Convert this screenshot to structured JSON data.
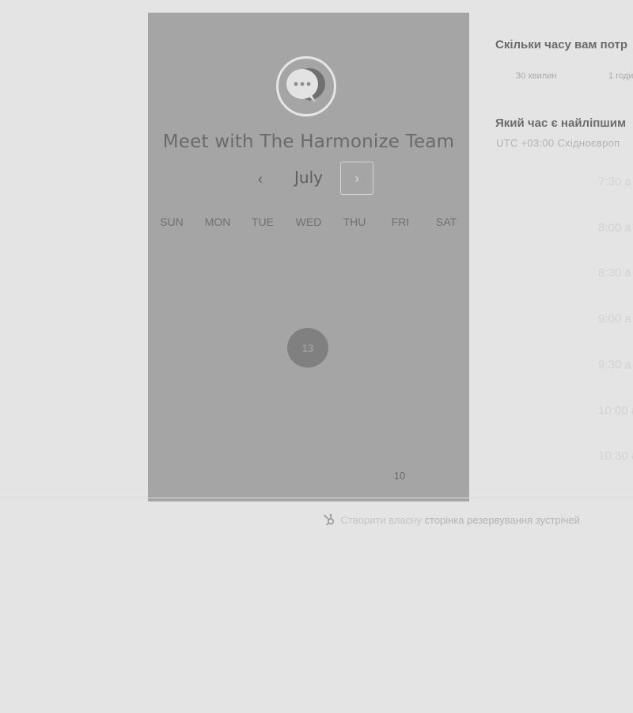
{
  "calendar": {
    "title": "Meet with The Harmonize Team",
    "month": "July",
    "prev_label": "‹",
    "next_label": "›",
    "weekdays": [
      "SUN",
      "MON",
      "TUE",
      "WED",
      "THU",
      "FRI",
      "SAT"
    ],
    "selected_day": "13",
    "visible_day": "10"
  },
  "duration": {
    "question": "Скільки часу вам потр",
    "options": [
      "30 хвилин",
      "1 годи"
    ]
  },
  "time": {
    "question": "Який час є найліпшим",
    "timezone": "UTC +03:00 Східноєвроп",
    "slots": [
      "7:30 а",
      "8:00 а",
      "8:30 а",
      "9:00 а",
      "9:30 а",
      "10:00 а",
      "10:30 а"
    ]
  },
  "footer": {
    "text_prefix": "Створити власну",
    "link_text": "сторінка резервування зустрічей"
  },
  "icons": {
    "avatar": "chat-bubble-icon",
    "footer": "hubspot-sprocket-icon"
  },
  "colors": {
    "panel": "#a5a5a5",
    "background": "#e4e4e4",
    "selected_day": "#808080"
  }
}
